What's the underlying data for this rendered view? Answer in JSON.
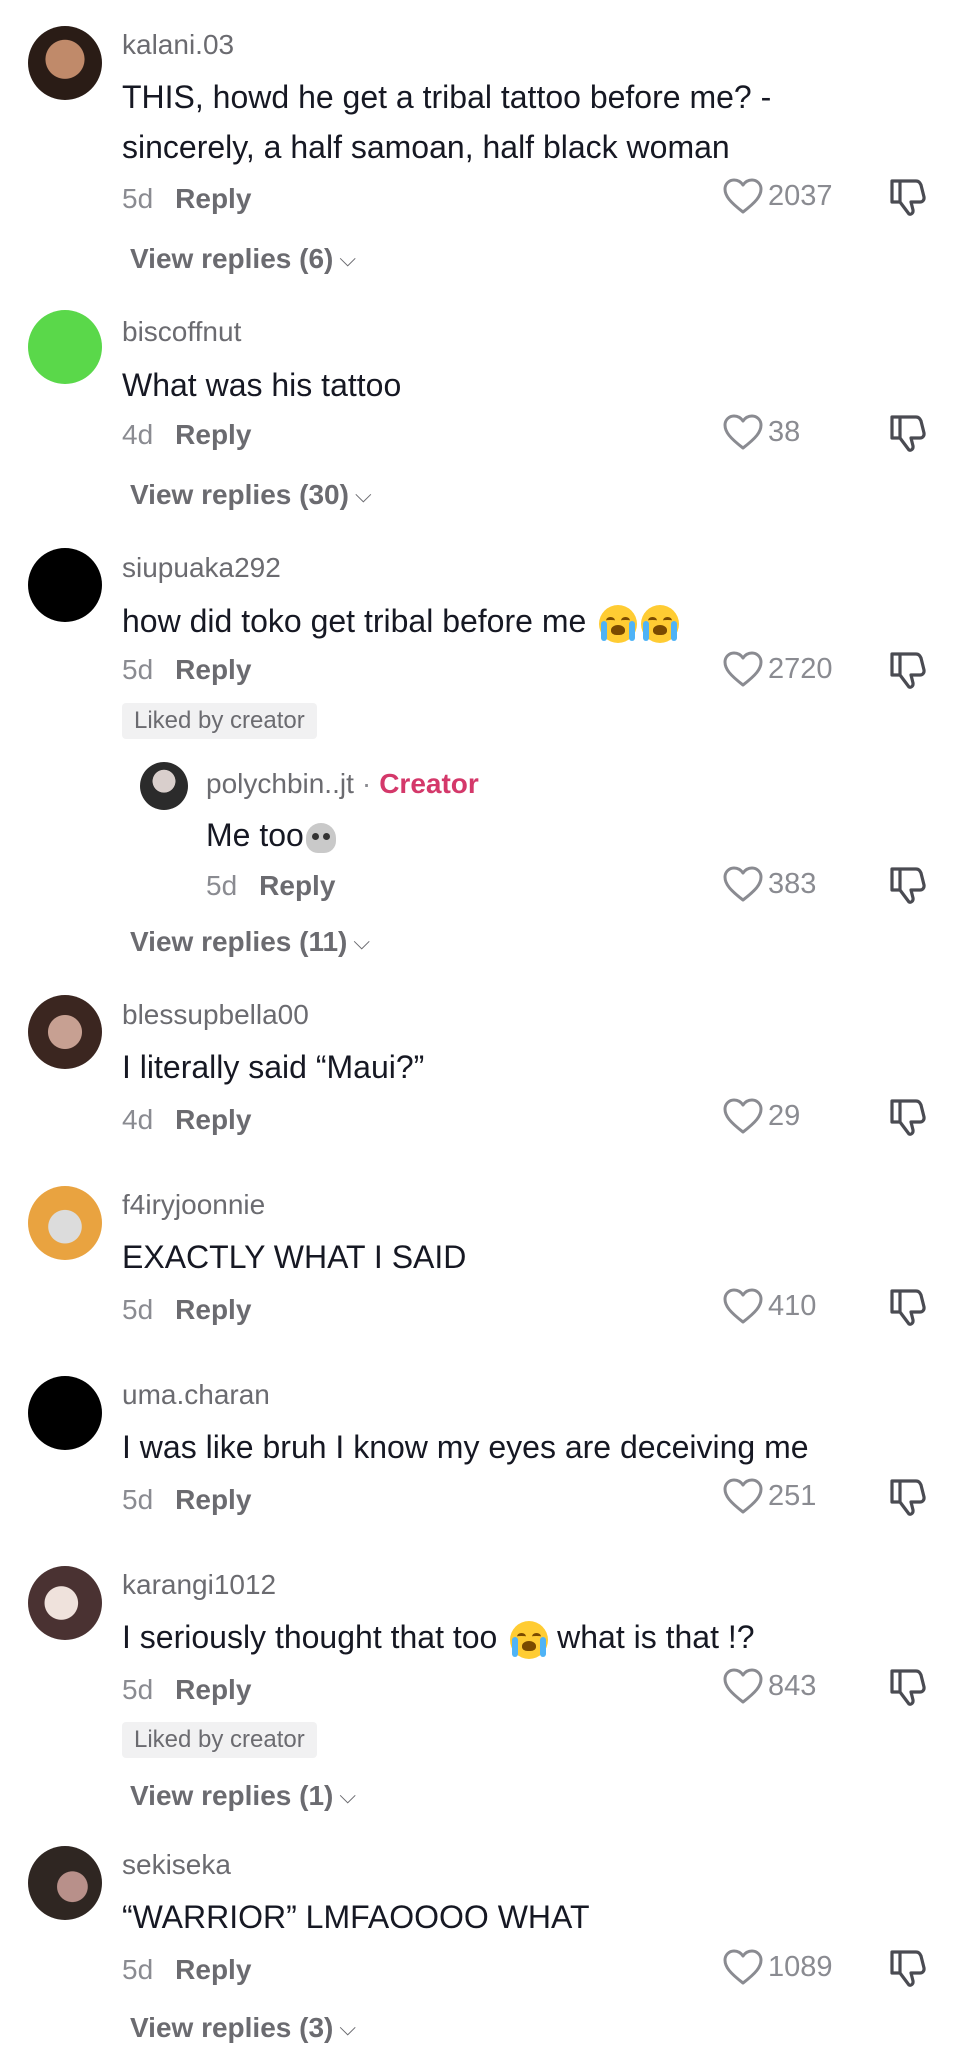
{
  "comments": [
    {
      "username": "kalani.03",
      "text": "THIS, howd he get a tribal tattoo before me? - sincerely, a half samoan, half black woman",
      "time": "5d",
      "reply": "Reply",
      "likes": "2037",
      "view_replies": "View replies (6)",
      "avatar_color": "#3a2a22"
    },
    {
      "username": "biscoffnut",
      "text": "What was his tattoo",
      "time": "4d",
      "reply": "Reply",
      "likes": "38",
      "view_replies": "View replies (30)",
      "avatar_color": "#52d43c"
    },
    {
      "username": "siupuaka292",
      "text": "how did toko get tribal before me",
      "time": "5d",
      "reply": "Reply",
      "likes": "2720",
      "liked_by": "Liked by creator",
      "avatar_color": "#000000"
    },
    {
      "username": "blessupbella00",
      "text": "I literally said “Maui?”",
      "time": "4d",
      "reply": "Reply",
      "likes": "29",
      "avatar_color": "#4a2f28"
    },
    {
      "username": "f4iryjoonnie",
      "text": "EXACTLY WHAT I SAID",
      "time": "5d",
      "reply": "Reply",
      "likes": "410",
      "avatar_color": "#e9a340"
    },
    {
      "username": "uma.charan",
      "text": "I was like bruh I know my eyes are deceiving me",
      "time": "5d",
      "reply": "Reply",
      "likes": "251",
      "avatar_color": "#000000"
    },
    {
      "username": "karangi1012",
      "text_before": "I seriously thought that too",
      "text_after": "what is that !?",
      "time": "5d",
      "reply": "Reply",
      "likes": "843",
      "liked_by": "Liked by creator",
      "view_replies": "View replies (1)",
      "avatar_color": "#5a4040"
    },
    {
      "username": "sekiseka",
      "text": "“WARRIOR” LMFAOOOO WHAT",
      "time": "5d",
      "reply": "Reply",
      "likes": "1089",
      "view_replies": "View replies (3)",
      "avatar_color": "#2f2622"
    }
  ],
  "creator_reply": {
    "username": "polychbin..jt",
    "badge": "Creator",
    "text": "Me too",
    "time": "5d",
    "reply": "Reply",
    "likes": "383",
    "view_replies": "View replies (11)",
    "avatar_color": "#2b2b2b"
  },
  "icons": {
    "like": "heart-icon",
    "dislike": "thumbs-down-icon",
    "chevron": "chevron-down-icon"
  }
}
